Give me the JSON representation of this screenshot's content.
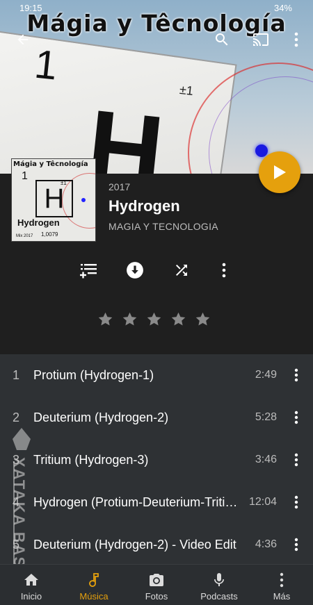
{
  "status_bar": {
    "time": "19:15",
    "battery": "34%"
  },
  "hero": {
    "banner": "Mágia y Têcnología",
    "art_symbol": "H",
    "art_number": "1",
    "art_charge": "±1"
  },
  "album": {
    "year": "2017",
    "title": "Hydrogen",
    "artist": "MAGIA Y TECNOLOGIA",
    "cover": {
      "title": "Mágia y Têcnología",
      "symbol": "H",
      "number": "1",
      "charge": "±1",
      "name": "Hydrogen",
      "mix": "Mix 2017",
      "mass": "1,0079"
    }
  },
  "colors": {
    "accent": "#e5a00d",
    "track_bg": "#2e3134",
    "info_bg": "#1f1f1f",
    "nav_bg": "#2b2e31"
  },
  "actions": [
    {
      "icon": "add-to-playlist-icon"
    },
    {
      "icon": "download-icon"
    },
    {
      "icon": "shuffle-icon"
    },
    {
      "icon": "more-vert-icon"
    }
  ],
  "rating": {
    "stars": 5,
    "value": 0
  },
  "tracks": [
    {
      "number": "1",
      "title": "Protium (Hydrogen-1)",
      "duration": "2:49"
    },
    {
      "number": "2",
      "title": "Deuterium (Hydrogen-2)",
      "duration": "5:28"
    },
    {
      "number": "3",
      "title": "Tritium (Hydrogen-3)",
      "duration": "3:46"
    },
    {
      "number": "4",
      "title": "Hydrogen (Protium-Deuterium-Tritium)",
      "duration": "12:04"
    },
    {
      "number": "5",
      "title": "Deuterium (Hydrogen-2) - Video Edit",
      "duration": "4:36"
    }
  ],
  "watermark": "XATAKA BASICS",
  "bottom_nav": [
    {
      "label": "Inicio",
      "icon": "home-icon"
    },
    {
      "label": "Música",
      "icon": "music-note-icon",
      "active": true
    },
    {
      "label": "Fotos",
      "icon": "camera-icon"
    },
    {
      "label": "Podcasts",
      "icon": "microphone-icon"
    },
    {
      "label": "Más",
      "icon": "more-vert-icon"
    }
  ]
}
